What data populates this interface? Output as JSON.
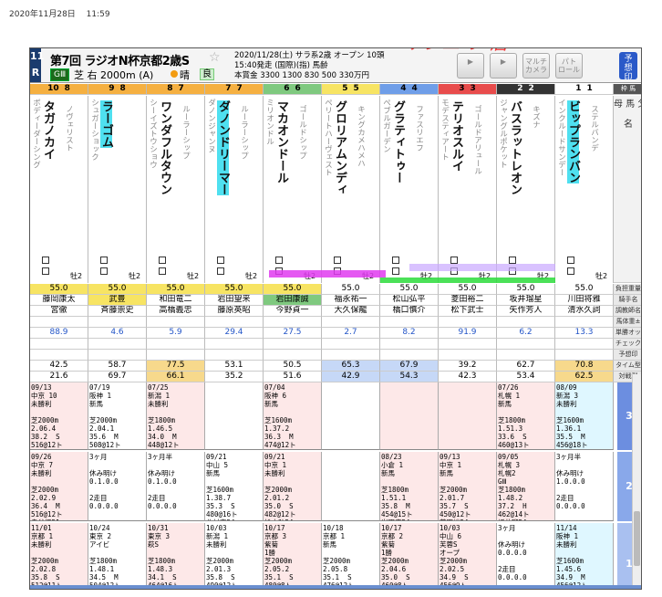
{
  "timestamp": "2020年11月28日　 11:59",
  "header": {
    "race_no_top": "11",
    "race_no_bot": "R",
    "title": "第7回 ラジオN杯京都2歳S",
    "grade": "GⅢ",
    "course": "芝 右 2000m (A)",
    "weather": "晴",
    "going": "良",
    "info1": "2020/11/28(土) サラ系2歳 オープン 10頭",
    "info2": "15:40発走 (国際)(指) 馬齢",
    "info3": "本賞金 3300 1300 830 500 330万円",
    "buttons": [
      "",
      "",
      "マルチ\nカメラ",
      "パト\nロール"
    ],
    "yoso": "予\n想\n印",
    "scribble": "ケンエ  フ  居"
  },
  "row_labels": {
    "waku": "枠 馬",
    "kigo": "馬記号/タグ",
    "name": "母 馬 父\n\n名",
    "weight": "負担重量",
    "jockey": "騎手名",
    "trainer": "調教師名",
    "horse_weight": "馬体重±",
    "odds": "単勝オッズ",
    "check": "チェック",
    "yoso": "予想印",
    "time": "タイム型DM",
    "taisen": "対戦型DM"
  },
  "horses": [
    {
      "waku": "10",
      "wakuno": "8",
      "num": "10",
      "color": "#f5b041",
      "sire": "ボディーダーシング",
      "name": "タガノカイ",
      "dam": "ノヴェリスト",
      "sex": "牡2",
      "wt": "55.0",
      "jockey": "藤岡康太",
      "trainer": "宮徹",
      "odds": "88.9",
      "t1": "42.5",
      "t2": "21.6"
    },
    {
      "waku": "9",
      "wakuno": "8",
      "num": "9",
      "color": "#f5b041",
      "sire": "シュガーショック",
      "name": "ラーゴム",
      "dam": "",
      "sex": "牡2",
      "wt": "55.0",
      "jockey": "武豊",
      "trainer": "斉藤崇史",
      "odds": "4.6",
      "t1": "58.7",
      "t2": "69.7"
    },
    {
      "waku": "8",
      "wakuno": "7",
      "num": "8",
      "color": "#f5b041",
      "sire": "シーイズトウショウ",
      "name": "ワンダフルタウン",
      "dam": "ルーラーシップ",
      "sex": "牡2",
      "wt": "55.0",
      "jockey": "和田竜二",
      "trainer": "高橋義忠",
      "odds": "5.9",
      "t1": "77.5",
      "t2": "66.1"
    },
    {
      "waku": "7",
      "wakuno": "7",
      "num": "7",
      "color": "#f5b041",
      "sire": "ダノンジャンヌ",
      "name": "ダノンドリーマー",
      "dam": "ルーラーシップ",
      "sex": "牡2",
      "wt": "55.0",
      "jockey": "岩田望来",
      "trainer": "藤原英昭",
      "odds": "29.4",
      "t1": "53.1",
      "t2": "35.2"
    },
    {
      "waku": "6",
      "wakuno": "6",
      "num": "6",
      "color": "#7fc97f",
      "sire": "ミリオンドル",
      "name": "マカオンドール",
      "dam": "ゴールドシップ",
      "sex": "牡2",
      "wt": "55.0",
      "jockey": "岩田康誠",
      "trainer": "今野貞一",
      "odds": "27.5",
      "t1": "50.5",
      "t2": "51.6"
    },
    {
      "waku": "5",
      "wakuno": "5",
      "num": "5",
      "color": "#f7e463",
      "sire": "ペリートハーヴェスト",
      "name": "グロリアムンディ",
      "dam": "キングカメハメハ",
      "sex": "牡2",
      "wt": "55.0",
      "jockey": "福永祐一",
      "trainer": "大久保龍",
      "odds": "2.7",
      "t1": "65.3",
      "t2": "42.9"
    },
    {
      "waku": "4",
      "wakuno": "4",
      "num": "4",
      "color": "#6f9ee8",
      "sire": "ペブルガーデン",
      "name": "グラティトゥー",
      "dam": "ファスリエフ",
      "sex": "牡2",
      "wt": "55.0",
      "jockey": "松山弘平",
      "trainer": "橋口慎介",
      "odds": "8.2",
      "t1": "67.9",
      "t2": "54.3"
    },
    {
      "waku": "3",
      "wakuno": "3",
      "num": "3",
      "color": "#e84c4c",
      "sire": "モデスティアート",
      "name": "テリオスルイ",
      "dam": "ゴールドアリュール",
      "sex": "牡2",
      "wt": "55.0",
      "jockey": "菱田裕二",
      "trainer": "松下武士",
      "odds": "91.9",
      "t1": "39.2",
      "t2": "42.3"
    },
    {
      "waku": "2",
      "wakuno": "2",
      "num": "2",
      "color": "#333333",
      "sire": "ジャングルポケット",
      "name": "バスラットレオン",
      "dam": "キズナ",
      "sex": "牡2",
      "wt": "55.0",
      "jockey": "坂井瑠星",
      "trainer": "矢作芳人",
      "odds": "6.2",
      "t1": "62.7",
      "t2": "53.4"
    },
    {
      "waku": "1",
      "wakuno": "1",
      "num": "1",
      "color": "#ffffff",
      "sire": "インクルードサンデー",
      "name": "ビップランバン",
      "dam": "ステルバンデ",
      "sex": "牡2",
      "wt": "55.0",
      "jockey": "川田将雅",
      "trainer": "清水久詞",
      "odds": "13.3",
      "t1": "70.8",
      "t2": "62.5"
    }
  ],
  "races": {
    "row3": [
      "09/13\n中京 10\n未勝利\n\n芝2000m\n2.06.4\n38.2  S\n516@12ト\n藤岡佑54",
      "07/19\n阪神 1\n新馬\n\n芝2000m\n2.04.1\n35.6  M\n508@12ト\n北村友54",
      "07/25\n新潟 1\n未勝利\n\n芝1800m\n1.46.5\n34.0  M\n448@12ト\n和田竜54",
      "",
      "07/04\n阪神 6\n新馬\n\n芝1600m\n1.37.2\n36.3  M\n474@12ト\n岩田康54",
      "",
      "",
      "",
      "07/26\n札幌 1\n新馬\n\n芝1800m\n1.51.3\n33.6  S\n460@13ト\n藤岡佑54",
      "08/09\n新潟 3\n未勝利\n\n芝1600m\n1.36.1\n35.5  M\n456@18ト\n川田将54"
    ],
    "row2": [
      "09/26\n中京 7\n未勝利\n\n芝2000m\n2.02.9\n36.4  M\n516@12ト\n泉谷楓51",
      "3ヶ月\n\n休み明け\n0.1.0.0\n\n2走目\n0.0.0.0",
      "3ヶ月半\n\n休み明け\n0.1.0.0\n\n2走目\n0.0.0.0",
      "09/21\n中山 5\n新馬\n\n芝1600m\n1.38.7\n35.3  S\n480@16ト\n北村宏54",
      "09/21\n中京 1\n未勝利\n\n芝2000m\n2.01.2\n35.0  S\n482@12ト\n松山弘54",
      "",
      "08/23\n小倉 1\n新馬\n\n芝1800m\n1.51.1\n35.8  M\n454@15ト\n岩田康54",
      "09/13\n中京 1\n新馬\n\n芝2000m\n2.01.7\n35.7  S\n450@12ト\n菱田裕54",
      "09/05\n札幌 3\n札幌2\nGⅢ\n芝1800m\n1.48.2\n37.2  H\n462@14ト\n坂井瑠54",
      "3ヶ月半\n\n休み明け\n1.0.0.0\n\n2走目\n0.0.0.0"
    ],
    "row1": [
      "11/01\n京都 1\n未勝利\n\n芝2000m\n2.02.8\n35.8  S\n512@11ト\n泉谷楓52",
      "10/24\n東京 2\nアイビ\n\n芝1800m\n1.48.1\n34.5  M\n504@12ト\n北村友54",
      "10/31\n東京 3\n萩S\n\n芝1800m\n1.48.3\n34.1  S\n464@16ト\n和田竜55",
      "10/03\n新潟 1\n未勝利\n\n芝2000m\n2.01.3\n35.8  S\n490@12ト\n岩田望55",
      "10/17\n京都 3\n紫菊\n1勝\n芝2000m\n2.05.2\n35.1  S\n480@8ト\n松若風55",
      "10/18\n京都 1\n新馬\n\n芝2000m\n2.05.8\n35.1  S\n476@12ト\n福永祐55",
      "10/17\n京都 2\n紫菊\n1勝\n芝2000m\n2.04.6\n35.0  S\n460@8ト\n岩田康55",
      "10/03\n中山 6\n芙蓉S\nオープ\n芝2000m\n2.02.5\n34.9  S\n456@9ト\n菱田裕55",
      "3ヶ月\n\n休み明け\n0.0.0.0\n\n2走目\n0.0.0.0",
      "11/14\n阪神 1\n未勝利\n\n芝1600m\n1.45.6\n34.9  M\n456@12ト\n川田将55"
    ],
    "side": [
      "3",
      "2",
      "1"
    ]
  }
}
